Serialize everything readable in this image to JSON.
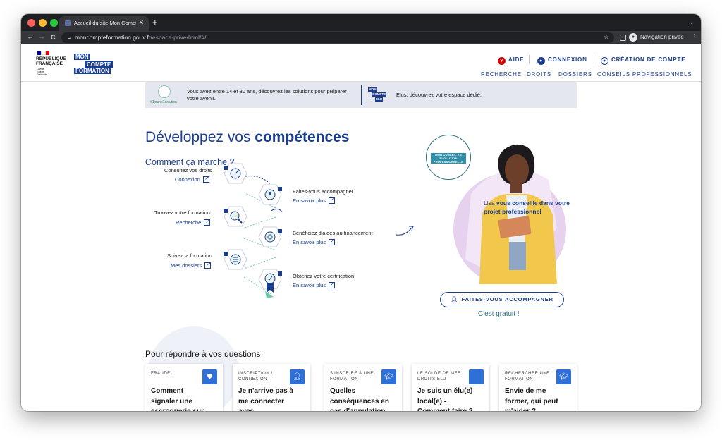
{
  "browser": {
    "tab_title": "Accueil du site Mon Compte Fo",
    "tab_close": "✕",
    "new_tab": "+",
    "url_host": "moncompteformation.gouv.fr",
    "url_path": "/espace-prive/html/#/",
    "private_label": "Navigation privée",
    "back": "←",
    "forward": "→",
    "reload": "C"
  },
  "header": {
    "rf_name": "RÉPUBLIQUE\nFRANÇAISE",
    "rf_motto": "Liberté\nÉgalité\nFraternité",
    "logo": {
      "l1": "MON",
      "l2": "COMPTE",
      "l3": "FORMATION"
    },
    "top_links": {
      "aide": "AIDE",
      "connexion": "CONNEXION",
      "creation": "CRÉATION DE COMPTE"
    },
    "menu": [
      "RECHERCHE",
      "DROITS",
      "DOSSIERS",
      "CONSEILS PROFESSIONNELS"
    ],
    "colors": {
      "primary": "#1a3d8f",
      "aide_icon": "#ce0500"
    }
  },
  "banner": {
    "tag": "#1jeune1solution",
    "text1": "Vous avez entre 14 et 30 ans, découvrez les solutions pour préparer votre avenir.",
    "mini_logo": {
      "l1": "MON",
      "l2": "COMPTE",
      "l3": "ELU"
    },
    "text2": "Élus, découvrez votre espace dédié."
  },
  "hero": {
    "title_light": "Développez vos ",
    "title_bold": "compétences",
    "how": "Comment ça marche ?",
    "badge": "MON CONSEIL EN ÉVOLUTION PROFESSIONNELLE",
    "consult_light": "Lisa ",
    "consult_bold": "vous conseille dans votre projet professionnel",
    "cta": "FAITES-VOUS ACCOMPAGNER",
    "free": "C'est gratuit !"
  },
  "steps": [
    {
      "title": "Consultez vos droits",
      "link": "Connexion"
    },
    {
      "title": "Faites-vous accompagner",
      "link": "En savoir plus"
    },
    {
      "title": "Trouvez votre formation",
      "link": "Recherche"
    },
    {
      "title": "Bénéficiez d'aides au financement",
      "link": "En savoir plus"
    },
    {
      "title": "Suivez la formation",
      "link": "Mes dossiers"
    },
    {
      "title": "Obtenez votre certification",
      "link": "En savoir plus"
    }
  ],
  "questions": {
    "heading": "Pour répondre à vos questions",
    "cards": [
      {
        "category": "FRAUDE",
        "question": "Comment signaler une escroquerie sur Mon Compte",
        "icon": "shield-icon"
      },
      {
        "category": "INSCRIPTION / CONNEXION",
        "question": "Je n'arrive pas à me connecter avec FranceConnect,",
        "icon": "user-icon"
      },
      {
        "category": "S'INSCRIRE À UNE FORMATION",
        "question": "Quelles conséquences en cas d'annulation",
        "icon": "graduation-cap-icon"
      },
      {
        "category": "LE SOLDE DE MES DROITS ELU",
        "question": "Je suis un élu(e) local(e) - Comment faire ?",
        "icon": "blank-icon"
      },
      {
        "category": "RECHERCHER UNE FORMATION",
        "question": "Envie de me former, qui peut m'aider ?",
        "icon": "graduation-cap-icon"
      }
    ]
  }
}
